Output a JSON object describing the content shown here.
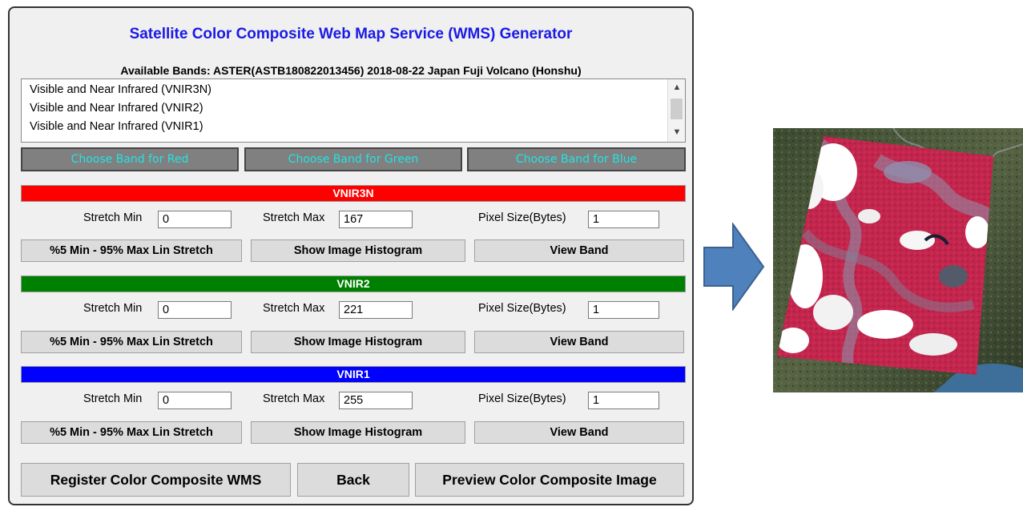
{
  "title": "Satellite Color Composite Web Map Service (WMS) Generator",
  "available_bands": "Available Bands: ASTER(ASTB180822013456) 2018-08-22 Japan Fuji Volcano (Honshu)",
  "band_list": [
    "Visible and Near Infrared (VNIR3N)",
    "Visible and Near Infrared (VNIR2)",
    "Visible and Near Infrared (VNIR1)"
  ],
  "choose_buttons": {
    "red": "Choose Band for Red",
    "green": "Choose Band for Green",
    "blue": "Choose Band for Blue"
  },
  "channels": [
    {
      "band": "VNIR3N",
      "color": "#ff0000",
      "stretch_min": "0",
      "stretch_max": "167",
      "pixel_size": "1"
    },
    {
      "band": "VNIR2",
      "color": "#008000",
      "stretch_min": "0",
      "stretch_max": "221",
      "pixel_size": "1"
    },
    {
      "band": "VNIR1",
      "color": "#0000ff",
      "stretch_min": "0",
      "stretch_max": "255",
      "pixel_size": "1"
    }
  ],
  "labels": {
    "stretch_min": "Stretch Min",
    "stretch_max": "Stretch Max",
    "pixel_size": "Pixel Size(Bytes)",
    "lin_stretch": "%5 Min - 95% Max Lin Stretch",
    "histogram": "Show Image Histogram",
    "view_band": "View Band"
  },
  "footer": {
    "register": "Register Color Composite WMS",
    "back": "Back",
    "preview": "Preview Color Composite Image"
  },
  "colors": {
    "title": "#1a1ae6",
    "choose_text": "#23e3e3",
    "arrow": "#4f81bd"
  }
}
